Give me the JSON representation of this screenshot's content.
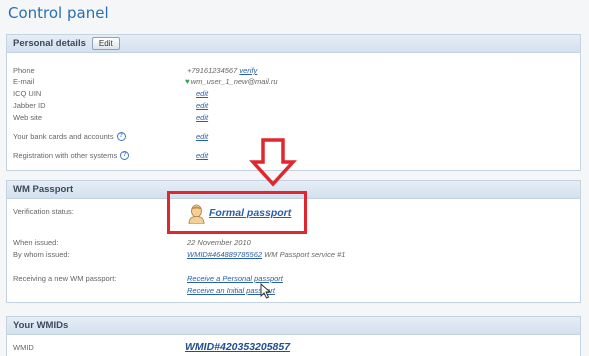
{
  "page": {
    "title": "Control panel"
  },
  "personal": {
    "header": "Personal details",
    "edit_label": "Edit",
    "rows": {
      "phone_label": "Phone",
      "phone_value": "+79161234567",
      "phone_action": "verify",
      "email_label": "E-mail",
      "email_value": "wm_user_1_new@mail.ru",
      "icq_label": "ICQ UIN",
      "icq_action": "edit",
      "jabber_label": "Jabber ID",
      "jabber_action": "edit",
      "website_label": "Web site",
      "website_action": "edit",
      "bank_label": "Your bank cards and accounts",
      "bank_action": "edit",
      "reg_label": "Registration with other systems",
      "reg_action": "edit",
      "help_glyph": "?"
    }
  },
  "passport": {
    "header": "WM Passport",
    "verification_label": "Verification status:",
    "passport_link": "Formal passport",
    "when_label": "When issued:",
    "when_value": "22 November 2010",
    "bywhom_label": "By whom issued:",
    "bywhom_link": "WMID#464889785562",
    "bywhom_suffix": "WM Passport service #1",
    "receiving_label": "Receiving a new WM passport:",
    "receive_personal": "Receive a Personal passport",
    "receive_initial": "Receive an Initial passport"
  },
  "wmids": {
    "header": "Your WMIDs",
    "wmid_label": "WMID",
    "wmid_value": "WMID#420353205857"
  },
  "colors": {
    "accent": "#2a5fa8",
    "highlight": "#e0262e",
    "verified": "#3aa34a"
  },
  "icons": [
    "help-icon",
    "heart-icon",
    "down-arrow-icon",
    "avatar-icon",
    "cursor-icon"
  ]
}
